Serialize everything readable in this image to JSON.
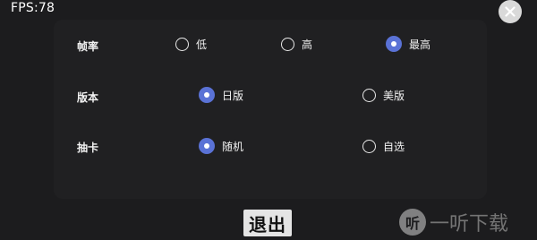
{
  "fps": "FPS:78",
  "rows": [
    {
      "label": "帧率",
      "options": [
        {
          "label": "低",
          "selected": false
        },
        {
          "label": "高",
          "selected": false
        },
        {
          "label": "最高",
          "selected": true
        }
      ]
    },
    {
      "label": "版本",
      "options": [
        {
          "label": "日版",
          "selected": true
        },
        {
          "label": "美版",
          "selected": false
        }
      ]
    },
    {
      "label": "抽卡",
      "options": [
        {
          "label": "随机",
          "selected": true
        },
        {
          "label": "自选",
          "selected": false
        }
      ]
    }
  ],
  "exit_label": "退出",
  "watermark": {
    "logo": "听",
    "text": "一听下载"
  },
  "colors": {
    "accent": "#5a72d6",
    "background": "#1c1c1e"
  }
}
